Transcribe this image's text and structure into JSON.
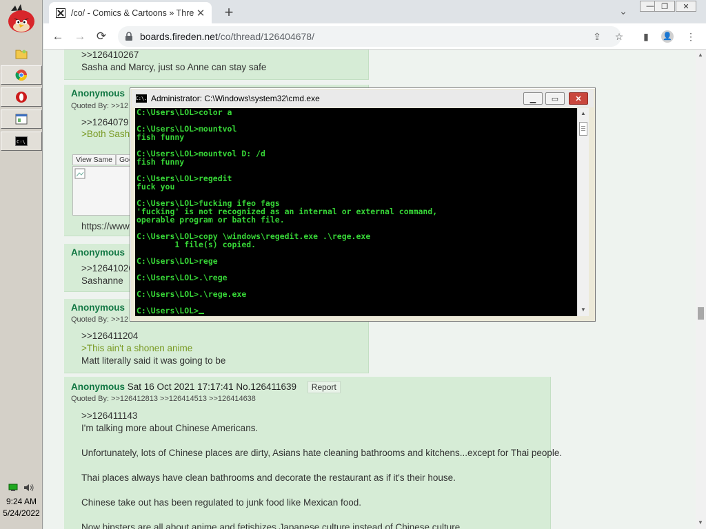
{
  "taskbar": {
    "clock_time": "9:24 AM",
    "clock_date": "5/24/2022",
    "buttons": [
      {
        "icon": "folder-icon",
        "active": false
      },
      {
        "icon": "chrome-icon",
        "active": true
      },
      {
        "icon": "opera-icon",
        "active": true
      },
      {
        "icon": "window-icon",
        "active": true
      },
      {
        "icon": "cmd-icon",
        "active": true
      }
    ],
    "logo": "angry-bird-logo"
  },
  "browser": {
    "tab_title": "/co/ - Comics & Cartoons » Thre",
    "url_host": "boards.fireden.net",
    "url_path": "/co/thread/126404678/",
    "new_tab_label": "+",
    "back_label": "←",
    "forward_label": "→",
    "reload_label": "⟳",
    "tab_close_label": "✕",
    "tab_search_label": "⌄",
    "win_minimize_label": "—",
    "win_maximize_label": "❐",
    "win_close_label": "✕",
    "lock_label": "🔒",
    "share_label": "⇪",
    "bookmark_label": "☆",
    "sidebar_label": "▮",
    "profile_label": "👤",
    "menu_label": "⋮"
  },
  "posts": {
    "p1": {
      "quote_link": ">>126410267",
      "text": "Sasha and Marcy, just so Anne can stay safe"
    },
    "p2": {
      "name": "Anonymous",
      "quoted_by": "Quoted By: >>12",
      "quote_link": ">>1264079",
      "greentext": ">Both Sash",
      "btn_view_same": "View Same",
      "btn_google": "Goo",
      "link": "https://www."
    },
    "p3": {
      "name": "Anonymous",
      "quote_link": ">>12641026",
      "text": "Sashanne"
    },
    "p4": {
      "name": "Anonymous",
      "quoted_by": "Quoted By: >>12",
      "quote_link": ">>126411204",
      "greentext": ">This ain't a shonen anime",
      "text": "Matt literally said it was going to be"
    },
    "p5": {
      "name": "Anonymous",
      "date": "Sat 16 Oct 2021 17:17:41",
      "number": "No.126411639",
      "report": "Report",
      "quoted_by": "Quoted By: >>126412813 >>126414513 >>126414638",
      "quote_link": ">>126411143",
      "lines": [
        "I'm talking more about Chinese Americans.",
        "Unfortunately, lots of Chinese places are dirty, Asians hate cleaning bathrooms and kitchens...except for Thai people.",
        "Thai places always have clean bathrooms and decorate the restaurant as if it's their house.",
        "Chinese take out has been regulated to junk food like Mexican food.",
        "Now hipsters are all about anime and fetishizes Japanese culture instead of Chinese culture."
      ]
    }
  },
  "cmd": {
    "title": "Administrator: C:\\Windows\\system32\\cmd.exe",
    "icon_text": "C:\\.",
    "btn_minimize": "▁",
    "btn_maximize": "▭",
    "btn_close": "✕",
    "scroll_up": "▲",
    "scroll_down": "▼",
    "text_color": "#37d637",
    "lines": [
      "C:\\Users\\LOL>color a",
      "",
      "C:\\Users\\LOL>mountvol",
      "fish funny",
      "",
      "C:\\Users\\LOL>mountvol D: /d",
      "fish funny",
      "",
      "C:\\Users\\LOL>regedit",
      "fuck you",
      "",
      "C:\\Users\\LOL>fucking ifeo fags",
      "'fucking' is not recognized as an internal or external command,",
      "operable program or batch file.",
      "",
      "C:\\Users\\LOL>copy \\windows\\regedit.exe .\\rege.exe",
      "        1 file(s) copied.",
      "",
      "C:\\Users\\LOL>rege",
      "",
      "C:\\Users\\LOL>.\\rege",
      "",
      "C:\\Users\\LOL>.\\rege.exe",
      "",
      "C:\\Users\\LOL>"
    ]
  }
}
